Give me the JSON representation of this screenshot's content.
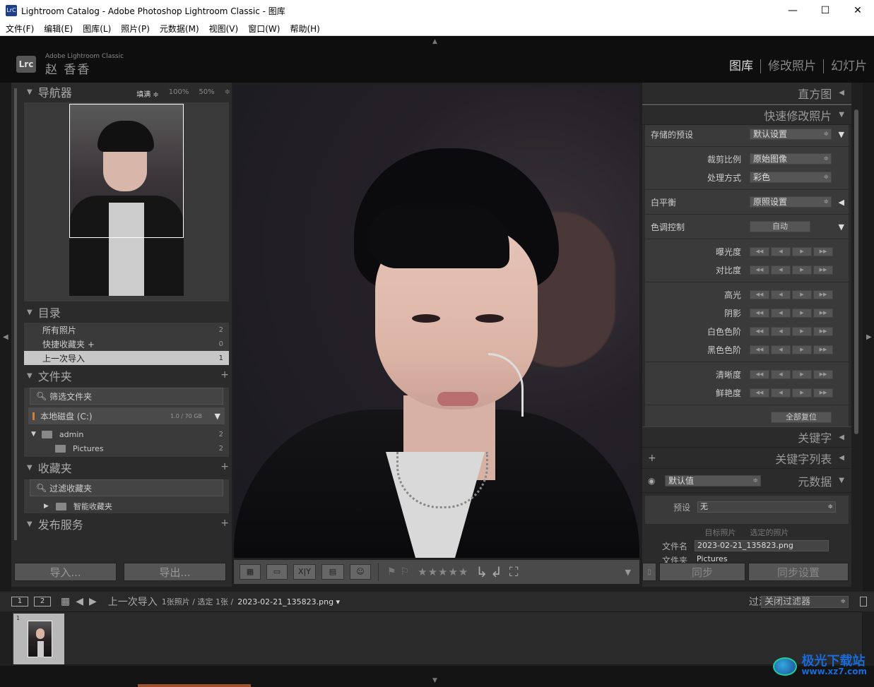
{
  "window": {
    "title": "Lightroom Catalog - Adobe Photoshop Lightroom Classic - 图库",
    "app_icon_text": "LrC",
    "minimize": "—",
    "maximize": "☐",
    "close": "✕"
  },
  "menu": [
    "文件(F)",
    "编辑(E)",
    "图库(L)",
    "照片(P)",
    "元数据(M)",
    "视图(V)",
    "窗口(W)",
    "帮助(H)"
  ],
  "identity": {
    "badge": "Lrc",
    "product": "Adobe Lightroom Classic",
    "user": "赵 香香",
    "modules": [
      "图库",
      "修改照片",
      "幻灯片"
    ]
  },
  "navigator": {
    "title": "导航器",
    "options": [
      "填满 ≑",
      "100%",
      "50%",
      "≑"
    ]
  },
  "catalog": {
    "title": "目录",
    "items": [
      {
        "label": "所有照片",
        "count": "2"
      },
      {
        "label": "快捷收藏夹 +",
        "count": "0"
      },
      {
        "label": "上一次导入",
        "count": "1"
      }
    ]
  },
  "folders": {
    "title": "文件夹",
    "search_placeholder": "筛选文件夹",
    "disk": {
      "label": "本地磁盘 (C:)",
      "size": "1.0 / 70 GB"
    },
    "items": [
      {
        "label": "admin",
        "count": "2"
      },
      {
        "label": "Pictures",
        "count": "2"
      }
    ]
  },
  "collections": {
    "title": "收藏夹",
    "search_placeholder": "过滤收藏夹",
    "items": [
      {
        "label": "智能收藏夹"
      }
    ]
  },
  "publish": {
    "title": "发布服务"
  },
  "left_buttons": {
    "import": "导入...",
    "export": "导出..."
  },
  "toolbar": {
    "compare": "X|Y",
    "stars": "★★★★★"
  },
  "right_panel": {
    "histogram": "直方图",
    "quick_develop": "快速修改照片",
    "saved_preset_label": "存储的预设",
    "saved_preset_value": "默认设置",
    "crop_label": "裁剪比例",
    "crop_value": "原始图像",
    "treatment_label": "处理方式",
    "treatment_value": "彩色",
    "wb_label": "白平衡",
    "wb_value": "原照设置",
    "tone_label": "色调控制",
    "tone_auto": "自动",
    "sliders": [
      "曝光度",
      "对比度",
      "高光",
      "阴影",
      "白色色阶",
      "黑色色阶",
      "清晰度",
      "鲜艳度"
    ],
    "reset_all": "全部复位",
    "keywording": "关键字",
    "keyword_list": "关键字列表",
    "metadata": "元数据",
    "metadata_preset_value": "默认值",
    "preset_label": "预设",
    "preset_value": "无",
    "target_tabs": [
      "目标照片",
      "选定的照片"
    ],
    "filename_label": "文件名",
    "filename_value": "2023-02-21_135823.png",
    "folder_label": "文件夹",
    "folder_value": "Pictures",
    "sync": "同步",
    "sync_settings": "同步设置"
  },
  "filmstrip": {
    "view1": "1",
    "view2": "2",
    "source": "上一次导入",
    "count_text": "1张照片 / 选定 1张 /",
    "file": "2023-02-21_135823.png ▾",
    "filter_label": "过滤器 :",
    "filter_value": "关闭过滤器",
    "thumb_index": "1"
  },
  "watermark": {
    "cn": "极光下载站",
    "url": "www.xz7.com"
  }
}
